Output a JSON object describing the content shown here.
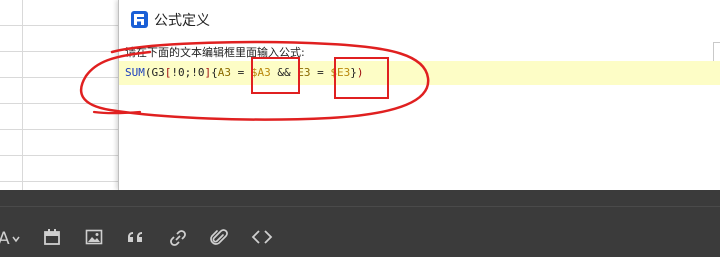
{
  "dialog": {
    "title": "公式定义",
    "prompt": "请在下面的文本编辑框里面输入公式:"
  },
  "formula": {
    "fn": "SUM",
    "p1": "(G3",
    "b1": "[",
    "idx": "!0;!0",
    "b2": "]",
    "brace_open": "{",
    "var_a": "A3",
    "eq1": " = ",
    "ref_a": "$A3",
    "and": " && ",
    "var_e": "E3",
    "eq2": " = ",
    "ref_e": "$E3",
    "brace_close": "}",
    "p2": ")"
  },
  "toolbar": {
    "icons": [
      "font-color-icon",
      "calendar-icon",
      "image-icon",
      "quote-icon",
      "link-icon",
      "attachment-icon",
      "code-icon"
    ]
  },
  "colors": {
    "editor_bg": "#fdfdc6",
    "function": "#1c3fbf",
    "reference": "#b8860b",
    "annotation": "#e02020",
    "toolbar_bg": "#3b3b3b"
  }
}
